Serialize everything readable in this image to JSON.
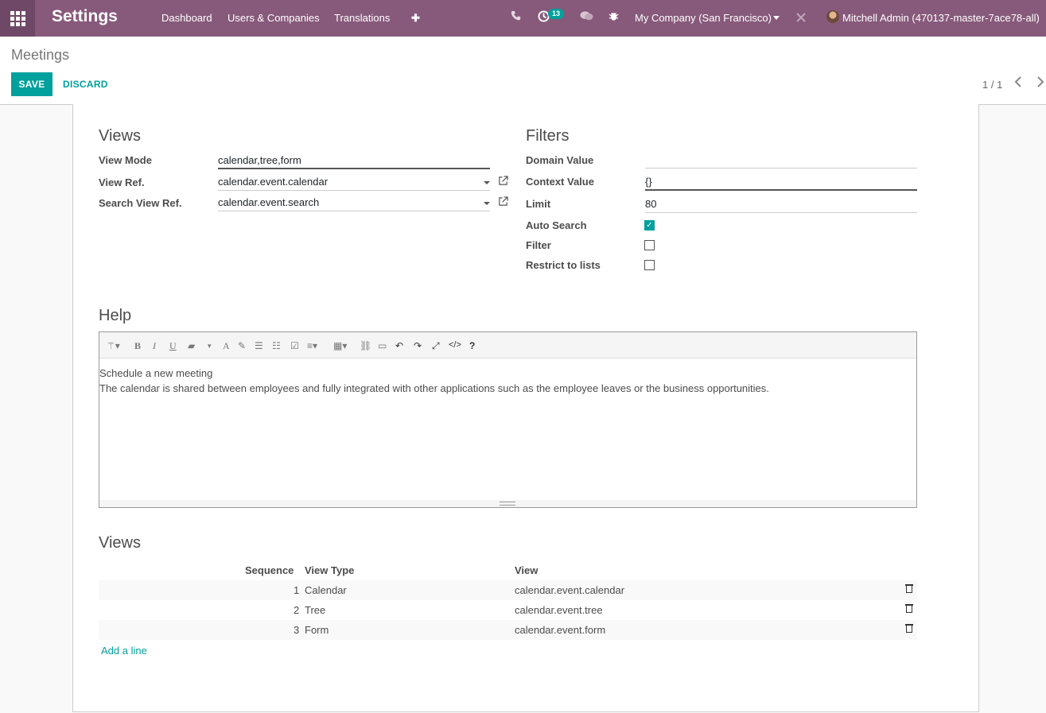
{
  "navbar": {
    "brand": "Settings",
    "menu": [
      "Dashboard",
      "Users & Companies",
      "Translations",
      "✚"
    ],
    "activity_count": "13",
    "company": "My Company (San Francisco)",
    "user": "Mitchell Admin (470137-master-7ace78-all)"
  },
  "control_panel": {
    "breadcrumb": "Meetings",
    "save_label": "SAVE",
    "discard_label": "DISCARD",
    "pager": "1 / 1"
  },
  "views_section": {
    "title": "Views",
    "view_mode_label": "View Mode",
    "view_mode_value": "calendar,tree,form",
    "view_ref_label": "View Ref.",
    "view_ref_value": "calendar.event.calendar",
    "search_view_ref_label": "Search View Ref.",
    "search_view_ref_value": "calendar.event.search"
  },
  "filters_section": {
    "title": "Filters",
    "domain_label": "Domain Value",
    "domain_value": "",
    "context_label": "Context Value",
    "context_value": "{}",
    "limit_label": "Limit",
    "limit_value": "80",
    "auto_search_label": "Auto Search",
    "auto_search_checked": true,
    "filter_label": "Filter",
    "filter_checked": false,
    "restrict_label": "Restrict to lists",
    "restrict_checked": false
  },
  "help_section": {
    "title": "Help",
    "line1": "Schedule a new meeting",
    "line2": "The calendar is shared between employees and fully integrated with other applications such as the employee leaves or the business opportunities."
  },
  "views_table": {
    "title": "Views",
    "headers": {
      "sequence": "Sequence",
      "view_type": "View Type",
      "view": "View"
    },
    "rows": [
      {
        "sequence": "1",
        "view_type": "Calendar",
        "view": "calendar.event.calendar"
      },
      {
        "sequence": "2",
        "view_type": "Tree",
        "view": "calendar.event.tree"
      },
      {
        "sequence": "3",
        "view_type": "Form",
        "view": "calendar.event.form"
      }
    ],
    "add_line": "Add a line"
  },
  "colors": {
    "navbar": "#875a7b",
    "accent": "#00a09d"
  }
}
